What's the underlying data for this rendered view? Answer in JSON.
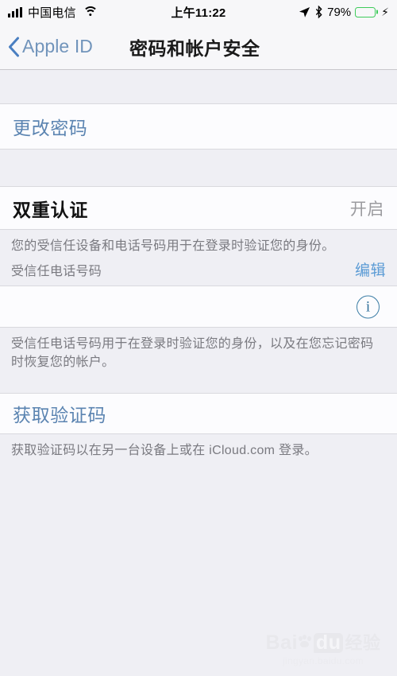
{
  "status_bar": {
    "signal_icon": "signal-bars-icon",
    "carrier": "中国电信",
    "wifi_icon": "wifi-icon",
    "time": "上午11:22",
    "location_icon": "location-arrow-icon",
    "bluetooth_icon": "bluetooth-icon",
    "battery_percent": "79%",
    "battery_icon": "battery-icon",
    "battery_level": 79,
    "charging_icon": "lightning-bolt-icon",
    "battery_color": "#3ecb5b"
  },
  "nav_bar": {
    "back_icon": "chevron-left-icon",
    "back_label": "Apple ID",
    "title": "密码和帐户安全",
    "accent_color": "#7194bb"
  },
  "sections": {
    "change_password": {
      "label": "更改密码"
    },
    "two_factor": {
      "title": "双重认证",
      "value": "开启",
      "footer": "您的受信任设备和电话号码用于在登录时验证您的身份。"
    },
    "trusted_numbers": {
      "header": "受信任电话号码",
      "action": "编辑",
      "redacted_number": "",
      "info_icon": "info-circle-icon",
      "info_glyph": "i",
      "footer": "受信任电话号码用于在登录时验证您的身份，以及在您忘记密码时恢复您的帐户。"
    },
    "verification_code": {
      "label": "获取验证码",
      "footer": "获取验证码以在另一台设备上或在 iCloud.com 登录。"
    }
  },
  "watermark": {
    "bai": "Bai",
    "paw_icon": "paw-print-icon",
    "du": "du",
    "cn": "经验",
    "url": "jingyan.baidu.com"
  }
}
